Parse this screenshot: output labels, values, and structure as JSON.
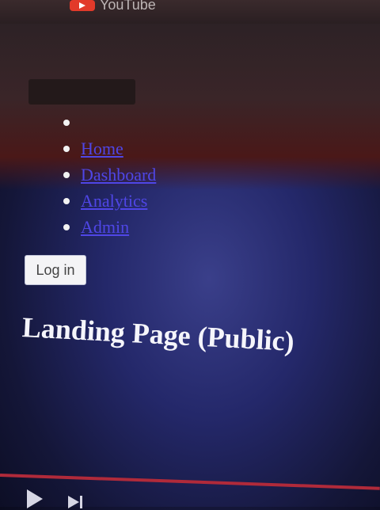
{
  "browser": {
    "site_name": "YouTube",
    "logo_icon": "youtube-play-icon",
    "brand_color": "#e23a2a"
  },
  "nav": {
    "items": [
      {
        "label": ""
      },
      {
        "label": "Home"
      },
      {
        "label": "Dashboard"
      },
      {
        "label": "Analytics"
      },
      {
        "label": "Admin"
      }
    ],
    "link_color": "#4f46e6"
  },
  "login_button": {
    "label": "Log in"
  },
  "page": {
    "title": "Landing Page (Public)"
  },
  "player": {
    "progress_color": "#b02a3a",
    "controls": [
      "play-icon",
      "next-icon"
    ]
  }
}
